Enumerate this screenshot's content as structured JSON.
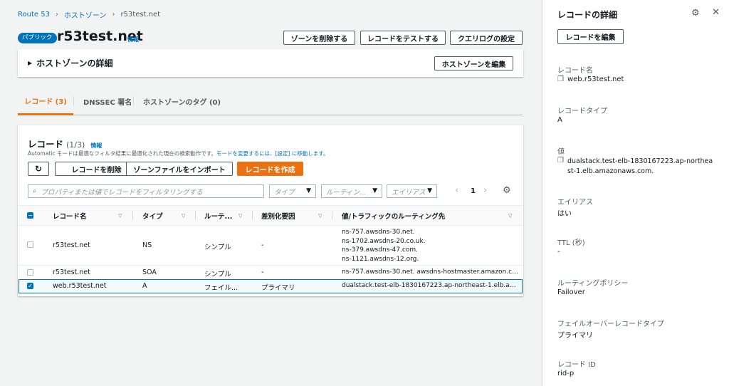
{
  "breadcrumb": {
    "items": [
      "Route 53",
      "ホストゾーン",
      "r53test.net"
    ]
  },
  "header": {
    "badge": "パブリック",
    "title": "r53test.net",
    "info": "情報",
    "actions": [
      "ゾーンを削除する",
      "レコードをテストする",
      "クエリログの設定"
    ]
  },
  "zone_details": {
    "title": "ホストゾーンの詳細",
    "edit_button": "ホストゾーンを編集"
  },
  "tabs": [
    {
      "label": "レコード (3)",
      "active": true
    },
    {
      "label": "DNSSEC 署名",
      "active": false
    },
    {
      "label": "ホストゾーンのタグ (0)",
      "active": false
    }
  ],
  "records": {
    "title": "レコード",
    "count": "(1/3)",
    "info": "情報",
    "desc_prefix": "Automatic モードは最適なフィルタ結果に最適化された現在の検索動作です。",
    "desc_link": "モードを変更するには、[設定] に移動します。",
    "buttons": {
      "delete": "レコードを削除",
      "import": "ゾーンファイルをインポート",
      "create": "レコードを作成"
    },
    "filter_placeholder": "プロパティまたは値でレコードをフィルタリングする",
    "type_select": "タイプ",
    "routing_select": "ルーティン...",
    "alias_select": "エイリアス",
    "page": "1",
    "columns": [
      "レコード名",
      "タイプ",
      "ルーテ...",
      "差別化要因",
      "値/トラフィックのルーティング先"
    ],
    "rows": [
      {
        "name": "r53test.net",
        "type": "NS",
        "routing": "シンプル",
        "diff": "-",
        "values": [
          "ns-757.awsdns-30.net.",
          "ns-1702.awsdns-20.co.uk.",
          "ns-379.awsdns-47.com.",
          "ns-1121.awsdns-12.org."
        ],
        "checked": false
      },
      {
        "name": "r53test.net",
        "type": "SOA",
        "routing": "シンプル",
        "diff": "-",
        "values": [
          "ns-757.awsdns-30.net. awsdns-hostmaster.amazon.co..."
        ],
        "checked": false
      },
      {
        "name": "web.r53test.net",
        "type": "A",
        "routing": "フェイル...",
        "diff": "プライマリ",
        "values": [
          "dualstack.test-elb-1830167223.ap-northeast-1.elb.am..."
        ],
        "checked": true
      }
    ]
  },
  "details_panel": {
    "title": "レコードの詳細",
    "edit_button": "レコードを編集",
    "fields": [
      {
        "label": "レコード名",
        "value": "web.r53test.net",
        "copy": true
      },
      {
        "label": "レコードタイプ",
        "value": "A"
      },
      {
        "label": "値",
        "value": "dualstack.test-elb-1830167223.ap-northeast-1.elb.amazonaws.com.",
        "copy": true
      },
      {
        "label": "エイリアス",
        "value": "はい"
      },
      {
        "label": "TTL (秒)",
        "value": "-"
      },
      {
        "label": "ルーティングポリシー",
        "value": "Failover"
      },
      {
        "label": "フェイルオーバーレコードタイプ",
        "value": "プライマリ"
      },
      {
        "label": "レコード ID",
        "value": "rid-p"
      }
    ]
  }
}
